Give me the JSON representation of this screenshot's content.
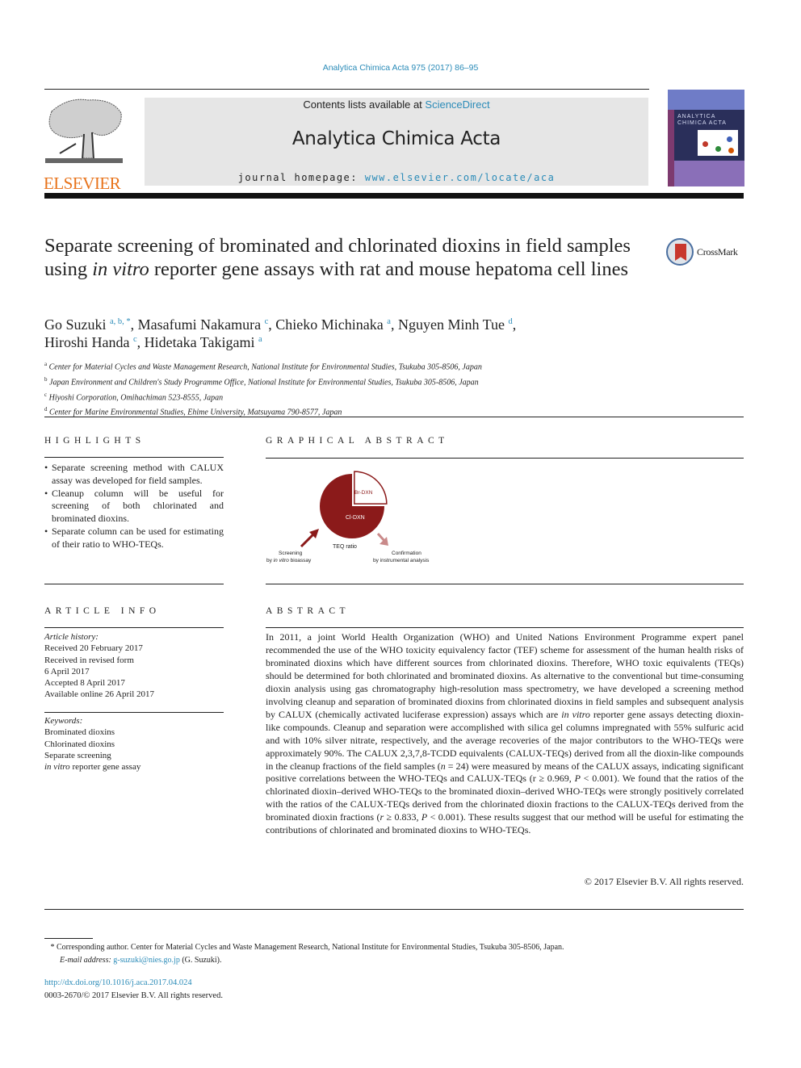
{
  "journal_ref": "Analytica Chimica Acta 975 (2017) 86–95",
  "header": {
    "contents_prefix": "Contents lists available at ",
    "contents_link": "ScienceDirect",
    "journal_title": "Analytica Chimica Acta",
    "homepage_prefix": "journal homepage: ",
    "homepage_link": "www.elsevier.com/locate/aca",
    "publisher_logo_text": "ELSEVIER",
    "cover_title": "ANALYTICA CHIMICA ACTA"
  },
  "article": {
    "title_part1": "Separate screening of brominated and chlorinated dioxins in field samples using ",
    "title_italic": "in vitro",
    "title_part2": " reporter gene assays with rat and mouse hepatoma cell lines",
    "crossmark_label": "CrossMark",
    "authors": [
      {
        "name": "Go Suzuki",
        "sup": "a, b, *",
        "sep": ", "
      },
      {
        "name": "Masafumi Nakamura",
        "sup": "c",
        "sep": ", "
      },
      {
        "name": "Chieko Michinaka",
        "sup": "a",
        "sep": ", "
      },
      {
        "name": "Nguyen Minh Tue",
        "sup": "d",
        "sep": ","
      },
      {
        "name": "Hiroshi Handa",
        "sup": "c",
        "sep": ", "
      },
      {
        "name": "Hidetaka Takigami",
        "sup": "a",
        "sep": ""
      }
    ],
    "affiliations": [
      {
        "key": "a",
        "text": "Center for Material Cycles and Waste Management Research, National Institute for Environmental Studies, Tsukuba 305-8506, Japan"
      },
      {
        "key": "b",
        "text": "Japan Environment and Children's Study Programme Office, National Institute for Environmental Studies, Tsukuba 305-8506, Japan"
      },
      {
        "key": "c",
        "text": "Hiyoshi Corporation, Omihachiman 523-8555, Japan"
      },
      {
        "key": "d",
        "text": "Center for Marine Environmental Studies, Ehime University, Matsuyama 790-8577, Japan"
      }
    ]
  },
  "highlights": {
    "heading": "HIGHLIGHTS",
    "items": [
      "Separate screening method with CALUX assay was developed for field samples.",
      "Cleanup column will be useful for screening of both chlorinated and brominated dioxins.",
      "Separate column can be used for estimating of their ratio to WHO-TEQs."
    ]
  },
  "graphical_abstract": {
    "heading": "GRAPHICAL ABSTRACT",
    "pie_label_major": "Cl-DXN",
    "pie_label_minor": "Br-DXN",
    "center_label": "TEQ ratio",
    "left_label_line1": "Screening",
    "left_label_line2_prefix": "by ",
    "left_label_line2_italic": "in vitro",
    "left_label_line2_suffix": " bioassay",
    "right_label_line1": "Confirmation",
    "right_label_line2": "by instrumental analysis",
    "minor_fraction": 0.25,
    "colors": {
      "major": "#8b1a1a",
      "arrow_left": "#8b1a1a",
      "arrow_right": "#c98a8a"
    }
  },
  "article_info": {
    "heading": "ARTICLE INFO",
    "history_label": "Article history:",
    "history": [
      "Received 20 February 2017",
      "Received in revised form",
      "6 April 2017",
      "Accepted 8 April 2017",
      "Available online 26 April 2017"
    ],
    "keywords_label": "Keywords:",
    "keywords": [
      "Brominated dioxins",
      "Chlorinated dioxins",
      "Separate screening"
    ],
    "keyword_last_italic": "in vitro",
    "keyword_last_rest": " reporter gene assay"
  },
  "abstract": {
    "heading": "ABSTRACT",
    "p1": "In 2011, a joint World Health Organization (WHO) and United Nations Environment Programme expert panel recommended the use of the WHO toxicity equivalency factor (TEF) scheme for assessment of the human health risks of brominated dioxins which have different sources from chlorinated dioxins. Therefore, WHO toxic equivalents (TEQs) should be determined for both chlorinated and brominated dioxins. As alternative to the conventional but time-consuming dioxin analysis using gas chromatography high-resolution mass spectrometry, we have developed a screening method involving cleanup and separation of brominated dioxins from chlorinated dioxins in field samples and subsequent analysis by CALUX (chemically activated luciferase expression) assays which are ",
    "p1_italic": "in vitro",
    "p2": " reporter gene assays detecting dioxin-like compounds. Cleanup and separation were accomplished with silica gel columns impregnated with 55% sulfuric acid and with 10% silver nitrate, respectively, and the average recoveries of the major contributors to the WHO-TEQs were approximately 90%. The CALUX 2,3,7,8-TCDD equivalents (CALUX-TEQs) derived from all the dioxin-like compounds in the cleanup fractions of the field samples (",
    "n_italic": "n",
    "p3": " = 24) were measured by means of the CALUX assays, indicating significant positive correlations between the WHO-TEQs and CALUX-TEQs (r ≥ 0.969, ",
    "P1_italic": "P",
    "p4": " < 0.001). We found that the ratios of the chlorinated dioxin–derived WHO-TEQs to the brominated dioxin–derived WHO-TEQs were strongly positively correlated with the ratios of the CALUX-TEQs derived from the chlorinated dioxin fractions to the CALUX-TEQs derived from the brominated dioxin fractions (",
    "r_italic": "r",
    "p5": " ≥ 0.833, ",
    "P2_italic": "P",
    "p6": " < 0.001). These results suggest that our method will be useful for estimating the contributions of chlorinated and brominated dioxins to WHO-TEQs.",
    "copyright": "© 2017 Elsevier B.V. All rights reserved."
  },
  "footnote": {
    "star": "*",
    "corresponding": " Corresponding author. Center for Material Cycles and Waste Management Research, National Institute for Environmental Studies, Tsukuba 305-8506, Japan.",
    "email_label": "E-mail address: ",
    "email": "g-suzuki@nies.go.jp",
    "email_suffix": " (G. Suzuki).",
    "doi": "http://dx.doi.org/10.1016/j.aca.2017.04.024",
    "issn_line": "0003-2670/© 2017 Elsevier B.V. All rights reserved."
  }
}
